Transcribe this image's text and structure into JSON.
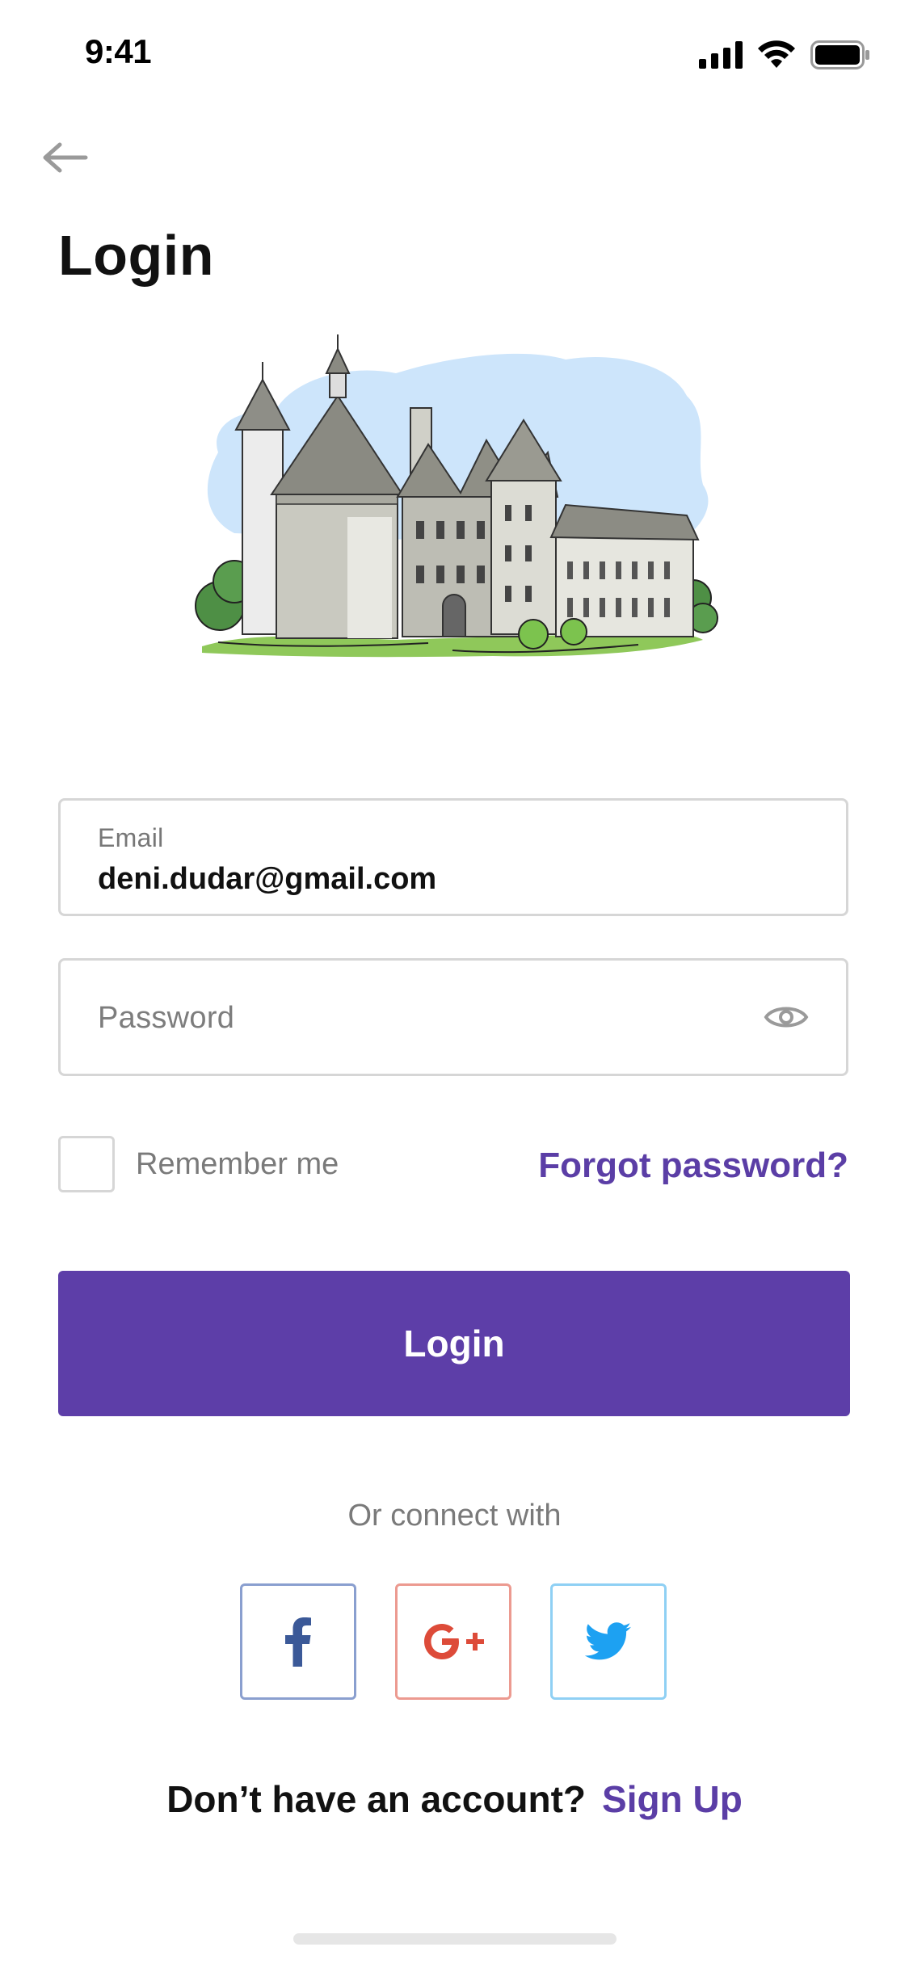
{
  "status_bar": {
    "time": "9:41"
  },
  "header": {
    "back_icon": "arrow-left-icon",
    "title": "Login"
  },
  "form": {
    "email": {
      "label": "Email",
      "value": "deni.dudar@gmail.com"
    },
    "password": {
      "placeholder": "Password",
      "toggle_icon": "eye-icon"
    },
    "remember_label": "Remember me",
    "forgot_label": "Forgot password?",
    "login_label": "Login"
  },
  "social": {
    "connect_text": "Or connect with",
    "providers": [
      "facebook-icon",
      "google-plus-icon",
      "twitter-icon"
    ]
  },
  "footer": {
    "prompt": "Don’t have an account?",
    "signup_label": "Sign Up"
  },
  "colors": {
    "accent": "#5d3ea8",
    "link": "#5b3ea6",
    "facebook": "#3b5998",
    "google": "#dd4b39",
    "twitter": "#1da1f2"
  }
}
